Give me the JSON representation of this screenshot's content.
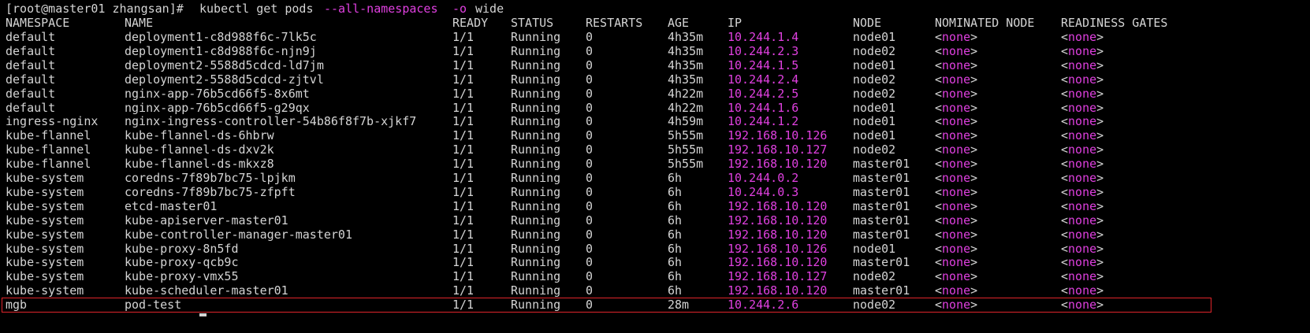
{
  "prompt": {
    "user_host": "[root@master01 zhangsan]#",
    "cmd": "kubectl get pods",
    "flag1": "--all-namespaces",
    "flag2": "-o",
    "arg": "wide"
  },
  "headers": [
    "NAMESPACE",
    "NAME",
    "READY",
    "STATUS",
    "RESTARTS",
    "AGE",
    "IP",
    "NODE",
    "NOMINATED NODE",
    "READINESS GATES"
  ],
  "rows": [
    [
      "default",
      "deployment1-c8d988f6c-7lk5c",
      "1/1",
      "Running",
      "0",
      "4h35m",
      "10.244.1.4",
      "node01",
      "none",
      "none"
    ],
    [
      "default",
      "deployment1-c8d988f6c-njn9j",
      "1/1",
      "Running",
      "0",
      "4h35m",
      "10.244.2.3",
      "node02",
      "none",
      "none"
    ],
    [
      "default",
      "deployment2-5588d5cdcd-ld7jm",
      "1/1",
      "Running",
      "0",
      "4h35m",
      "10.244.1.5",
      "node01",
      "none",
      "none"
    ],
    [
      "default",
      "deployment2-5588d5cdcd-zjtvl",
      "1/1",
      "Running",
      "0",
      "4h35m",
      "10.244.2.4",
      "node02",
      "none",
      "none"
    ],
    [
      "default",
      "nginx-app-76b5cd66f5-8x6mt",
      "1/1",
      "Running",
      "0",
      "4h22m",
      "10.244.2.5",
      "node02",
      "none",
      "none"
    ],
    [
      "default",
      "nginx-app-76b5cd66f5-g29qx",
      "1/1",
      "Running",
      "0",
      "4h22m",
      "10.244.1.6",
      "node01",
      "none",
      "none"
    ],
    [
      "ingress-nginx",
      "nginx-ingress-controller-54b86f8f7b-xjkf7",
      "1/1",
      "Running",
      "0",
      "4h59m",
      "10.244.1.2",
      "node01",
      "none",
      "none"
    ],
    [
      "kube-flannel",
      "kube-flannel-ds-6hbrw",
      "1/1",
      "Running",
      "0",
      "5h55m",
      "192.168.10.126",
      "node01",
      "none",
      "none"
    ],
    [
      "kube-flannel",
      "kube-flannel-ds-dxv2k",
      "1/1",
      "Running",
      "0",
      "5h55m",
      "192.168.10.127",
      "node02",
      "none",
      "none"
    ],
    [
      "kube-flannel",
      "kube-flannel-ds-mkxz8",
      "1/1",
      "Running",
      "0",
      "5h55m",
      "192.168.10.120",
      "master01",
      "none",
      "none"
    ],
    [
      "kube-system",
      "coredns-7f89b7bc75-lpjkm",
      "1/1",
      "Running",
      "0",
      "6h",
      "10.244.0.2",
      "master01",
      "none",
      "none"
    ],
    [
      "kube-system",
      "coredns-7f89b7bc75-zfpft",
      "1/1",
      "Running",
      "0",
      "6h",
      "10.244.0.3",
      "master01",
      "none",
      "none"
    ],
    [
      "kube-system",
      "etcd-master01",
      "1/1",
      "Running",
      "0",
      "6h",
      "192.168.10.120",
      "master01",
      "none",
      "none"
    ],
    [
      "kube-system",
      "kube-apiserver-master01",
      "1/1",
      "Running",
      "0",
      "6h",
      "192.168.10.120",
      "master01",
      "none",
      "none"
    ],
    [
      "kube-system",
      "kube-controller-manager-master01",
      "1/1",
      "Running",
      "0",
      "6h",
      "192.168.10.120",
      "master01",
      "none",
      "none"
    ],
    [
      "kube-system",
      "kube-proxy-8n5fd",
      "1/1",
      "Running",
      "0",
      "6h",
      "192.168.10.126",
      "node01",
      "none",
      "none"
    ],
    [
      "kube-system",
      "kube-proxy-qcb9c",
      "1/1",
      "Running",
      "0",
      "6h",
      "192.168.10.120",
      "master01",
      "none",
      "none"
    ],
    [
      "kube-system",
      "kube-proxy-vmx55",
      "1/1",
      "Running",
      "0",
      "6h",
      "192.168.10.127",
      "node02",
      "none",
      "none"
    ],
    [
      "kube-system",
      "kube-scheduler-master01",
      "1/1",
      "Running",
      "0",
      "6h",
      "192.168.10.120",
      "master01",
      "none",
      "none"
    ],
    [
      "mgb",
      "pod-test",
      "1/1",
      "Running",
      "0",
      "28m",
      "10.244.2.6",
      "node02",
      "none",
      "none"
    ]
  ],
  "highlighted_row_index": 19,
  "colors": {
    "background": "#000000",
    "text": "#d4d4d4",
    "accent_magenta": "#e040e0",
    "highlight_border": "#e0252b"
  }
}
